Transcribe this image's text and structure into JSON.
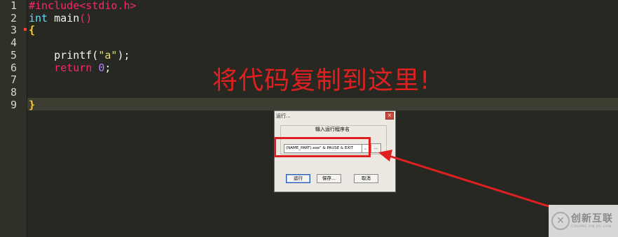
{
  "editor": {
    "lines": [
      {
        "num": "1",
        "tokens": [
          {
            "t": "#include<stdio.h>",
            "c": "t-pp"
          }
        ]
      },
      {
        "num": "2",
        "tokens": [
          {
            "t": "int",
            "c": "t-ty"
          },
          {
            "t": " main",
            "c": "t-fn"
          },
          {
            "t": "()",
            "c": "t-pp"
          }
        ]
      },
      {
        "num": "3",
        "tokens": [
          {
            "t": "{",
            "c": "t-br"
          }
        ]
      },
      {
        "num": "4",
        "tokens": []
      },
      {
        "num": "5",
        "tokens": [
          {
            "t": "    printf(",
            "c": "t-fn"
          },
          {
            "t": "\"a\"",
            "c": "t-str"
          },
          {
            "t": ");",
            "c": "t-fn"
          }
        ]
      },
      {
        "num": "6",
        "tokens": [
          {
            "t": "    ",
            "c": "t-fn"
          },
          {
            "t": "return",
            "c": "t-kw"
          },
          {
            "t": " ",
            "c": "t-fn"
          },
          {
            "t": "0",
            "c": "t-num"
          },
          {
            "t": ";",
            "c": "t-fn"
          }
        ]
      },
      {
        "num": "7",
        "tokens": []
      },
      {
        "num": "8",
        "tokens": []
      },
      {
        "num": "9",
        "tokens": [
          {
            "t": "}",
            "c": "t-br"
          }
        ]
      }
    ]
  },
  "annotation": "将代码复制到这里!",
  "dialog": {
    "title": "运行...",
    "close": "×",
    "group_label": "输入运行程序名",
    "command_value": "(NAME_PART).exe\" & PAUSE & EXIT",
    "dropdown_glyph": "⌄",
    "browse_label": "...",
    "run_label": "运行",
    "save_label": "保存...",
    "cancel_label": "取消"
  },
  "watermark": {
    "mark": "✕",
    "name": "创新互联",
    "sub": "CHUANG XIN HU LIAN"
  },
  "colors": {
    "background": "#272822",
    "annotation": "#e02020",
    "gutter": "#2f3129"
  }
}
